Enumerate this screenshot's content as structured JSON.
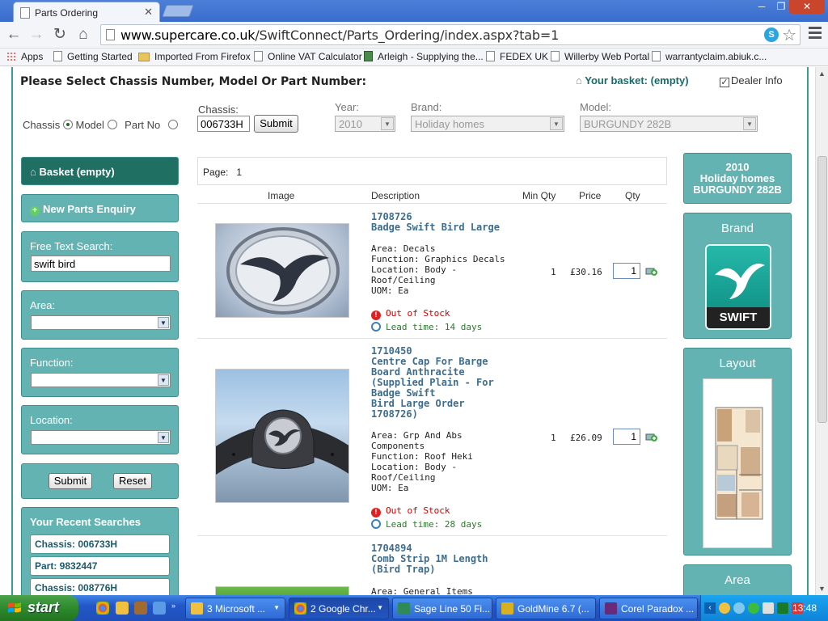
{
  "browser": {
    "tab_title": "Parts Ordering",
    "url_host": "www.supercare.co.uk",
    "url_path": "/SwiftConnect/Parts_Ordering/index.aspx?tab=1",
    "skype_label": "S",
    "window_min": "─",
    "window_max": "❐",
    "window_close": "✕"
  },
  "bookmarks": [
    {
      "label": "Apps",
      "icon": "apps-icon"
    },
    {
      "label": "Getting Started",
      "icon": "page-icon"
    },
    {
      "label": "Imported From Firefox",
      "icon": "folder-icon"
    },
    {
      "label": "Online VAT Calculator",
      "icon": "page-icon"
    },
    {
      "label": "Arleigh - Supplying the...",
      "icon": "site-icon"
    },
    {
      "label": "FEDEX UK",
      "icon": "page-icon"
    },
    {
      "label": "Willerby Web Portal",
      "icon": "page-icon"
    },
    {
      "label": "warrantyclaim.abiuk.c...",
      "icon": "page-icon"
    }
  ],
  "header": {
    "title": "Please Select Chassis Number, Model Or Part Number:",
    "basket": "Your basket: (empty)",
    "dealer_info": "Dealer Info",
    "dealer_info_checked": true
  },
  "search_mode": {
    "chassis": "Chassis",
    "model": "Model",
    "part_no": "Part No",
    "selected": "chassis"
  },
  "filters": {
    "chassis_label": "Chassis:",
    "chassis_value": "006733H",
    "submit": "Submit",
    "year_label": "Year:",
    "year_value": "2010",
    "brand_label": "Brand:",
    "brand_value": "Holiday homes",
    "model_label": "Model:",
    "model_value": "BURGUNDY 282B"
  },
  "sidebar": {
    "basket": "Basket (empty)",
    "new_enquiry": "New Parts Enquiry",
    "free_text_label": "Free Text Search:",
    "free_text_value": "swift bird",
    "area_label": "Area:",
    "function_label": "Function:",
    "location_label": "Location:",
    "submit": "Submit",
    "reset": "Reset",
    "recent_title": "Your Recent Searches",
    "recent": [
      "Chassis: 006733H",
      "Part: 9832447",
      "Chassis: 008776H"
    ]
  },
  "results": {
    "page_label": "Page:",
    "page_number": "1",
    "columns": {
      "image": "Image",
      "description": "Description",
      "min_qty": "Min Qty",
      "price": "Price",
      "qty": "Qty"
    },
    "items": [
      {
        "code": "1708726",
        "name": "Badge Swift Bird Large",
        "details": "Area: Decals\nFunction: Graphics Decals\nLocation: Body -\nRoof/Ceiling\nUOM: Ea",
        "min_qty": "1",
        "price": "£30.16",
        "qty": "1",
        "stock": "Out of Stock",
        "lead": "Lead time: 14 days"
      },
      {
        "code": "1710450",
        "name": "Centre Cap For Barge\nBoard Anthracite\n(Supplied Plain - For\nBadge Swift\nBird Large Order\n1708726)",
        "details": "Area: Grp And Abs\nComponents\nFunction: Roof Heki\nLocation: Body -\nRoof/Ceiling\nUOM: Ea",
        "min_qty": "1",
        "price": "£26.09",
        "qty": "1",
        "stock": "Out of Stock",
        "lead": "Lead time: 28 days"
      },
      {
        "code": "1704894",
        "name": "Comb Strip 1M Length\n(Bird Trap)",
        "details": "Area: General Items"
      }
    ]
  },
  "right_sidebar": {
    "year": "2010",
    "brand_name": "Holiday homes",
    "model": "BURGUNDY 282B",
    "brand_title": "Brand",
    "brand_logo_text": "SWIFT",
    "layout_title": "Layout",
    "area_title": "Area"
  },
  "taskbar": {
    "start": "start",
    "tasks": [
      {
        "label": "3 Microsoft ...",
        "icon": "outlook-icon"
      },
      {
        "label": "2 Google Chr...",
        "icon": "chrome-icon"
      },
      {
        "label": "Sage Line 50 Fi...",
        "icon": "sage-icon"
      },
      {
        "label": "GoldMine 6.7 (...",
        "icon": "goldmine-icon"
      },
      {
        "label": "Corel Paradox ...",
        "icon": "paradox-icon"
      }
    ],
    "clock": "13:48"
  }
}
